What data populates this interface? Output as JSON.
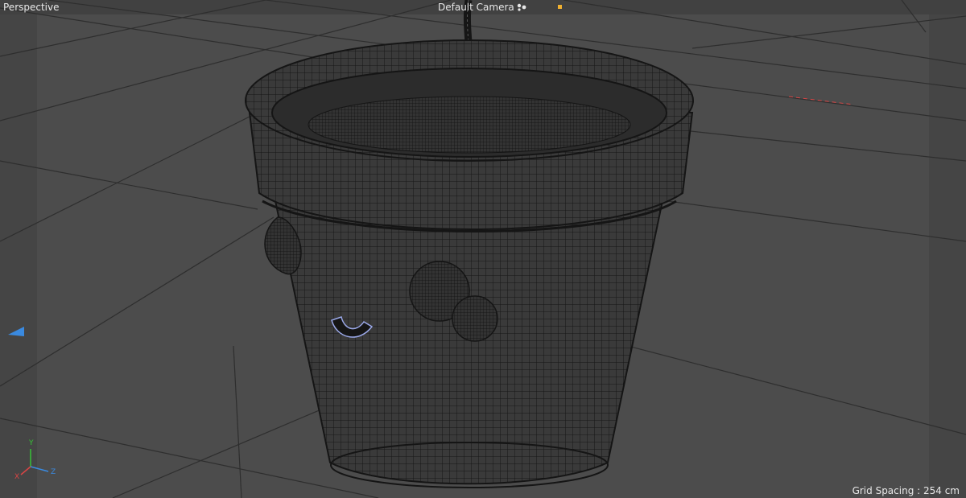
{
  "viewport": {
    "view_name": "Perspective",
    "camera": "Default Camera",
    "grid_spacing": "Grid Spacing : 254 cm",
    "axis_labels": {
      "y": "Y",
      "x": "X",
      "z": "Z"
    },
    "colors": {
      "background": "#4c4c4c",
      "grid": "#2e2e2e",
      "wire": "#1a1a1a",
      "object_fill": "#3a3a3a",
      "text": "#e8e8e8",
      "axis_y": "#36c236",
      "axis_x": "#d94545",
      "axis_z": "#3a8ae0",
      "highlight": "#9aa8e8",
      "camera_marker": "#f0b030"
    },
    "icons": [
      "camera-icon",
      "axis-gizmo-icon",
      "camera-marker-icon",
      "navigation-arrow-icon"
    ]
  }
}
